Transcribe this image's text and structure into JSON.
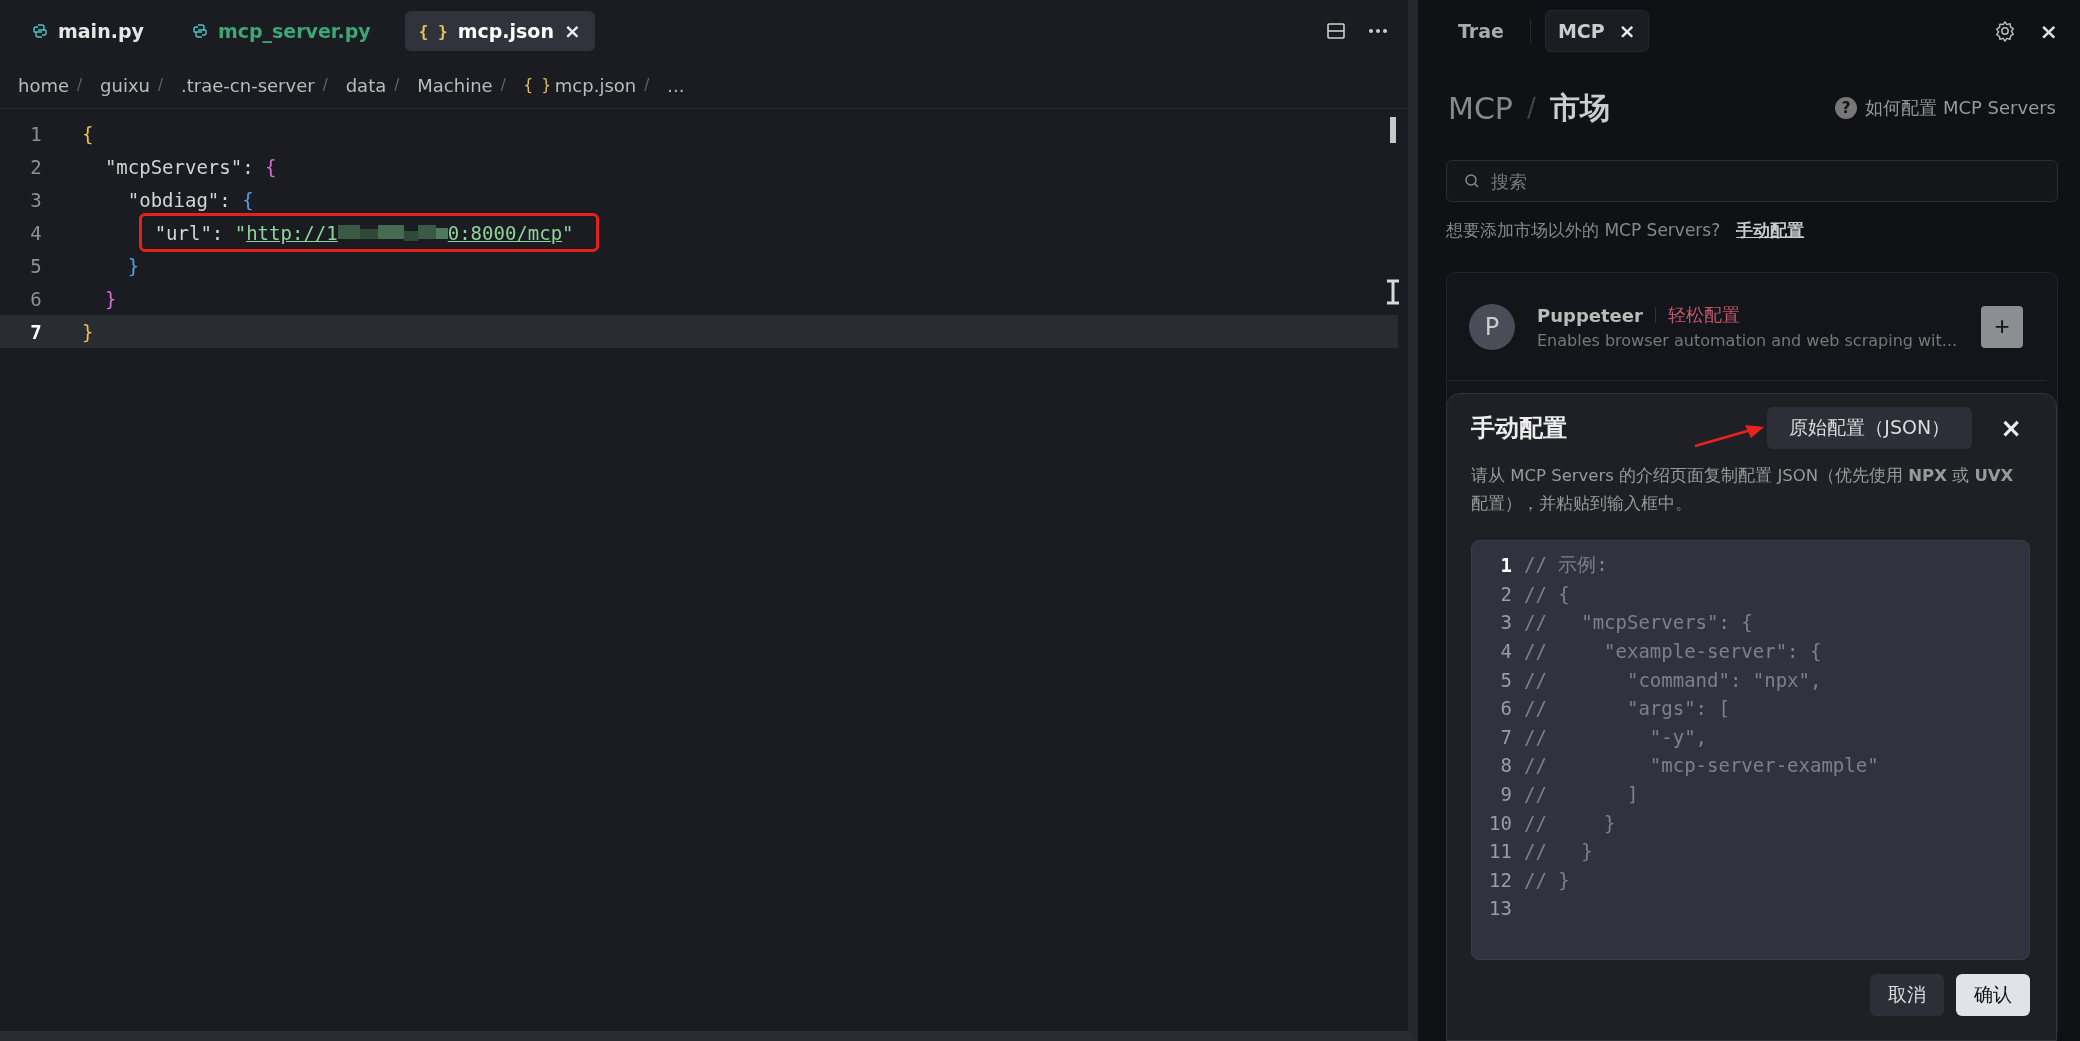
{
  "editor": {
    "tabs": [
      {
        "label": "main.py",
        "kind": "python",
        "selected": false,
        "color": "#e6e6e6"
      },
      {
        "label": "mcp_server.py",
        "kind": "python",
        "selected": false,
        "color": "#3ea675"
      },
      {
        "label": "mcp.json",
        "kind": "json",
        "icon_text": "{ }",
        "selected": true,
        "color": "#ffffff",
        "close": "×"
      }
    ],
    "breadcrumbs": [
      {
        "label": "home",
        "separator": "/"
      },
      {
        "label": "guixu",
        "separator": "/"
      },
      {
        "label": ".trae-cn-server",
        "separator": "/"
      },
      {
        "label": "data",
        "separator": "/"
      },
      {
        "label": "Machine",
        "separator": "/"
      },
      {
        "label": "mcp.json",
        "icon_text": "{ }",
        "separator": "/"
      },
      {
        "label": "..."
      }
    ],
    "lines": [
      {
        "number": "1",
        "current": false,
        "highlighted": false,
        "tokens": [
          {
            "kind": "brace",
            "text": "{",
            "color": "#e8c547"
          }
        ]
      },
      {
        "number": "2",
        "current": false,
        "highlighted": false,
        "tokens": [
          {
            "kind": "plain",
            "text": "  \"mcpServers\": "
          },
          {
            "kind": "brace",
            "text": "{",
            "color": "#d36fd0"
          }
        ]
      },
      {
        "number": "3",
        "current": false,
        "highlighted": false,
        "tokens": [
          {
            "kind": "plain",
            "text": "    \"obdiag\": "
          },
          {
            "kind": "brace",
            "text": "{",
            "color": "#4aa3f0"
          }
        ]
      },
      {
        "number": "4",
        "current": false,
        "highlighted": true,
        "tokens": [
          {
            "kind": "plain",
            "text": "      \"url\": "
          },
          {
            "kind": "string",
            "text": "\""
          },
          {
            "kind": "link",
            "text": "http://1"
          },
          {
            "kind": "redacted"
          },
          {
            "kind": "link",
            "text": "0:8000/mcp"
          },
          {
            "kind": "string",
            "text": "\""
          }
        ]
      },
      {
        "number": "5",
        "current": false,
        "highlighted": false,
        "tokens": [
          {
            "kind": "brace",
            "text": "    }",
            "color": "#4aa3f0"
          }
        ]
      },
      {
        "number": "6",
        "current": false,
        "highlighted": false,
        "tokens": [
          {
            "kind": "brace",
            "text": "  }",
            "color": "#d36fd0"
          }
        ]
      },
      {
        "number": "7",
        "current": true,
        "highlighted": false,
        "tokens": [
          {
            "kind": "brace",
            "text": "}",
            "color": "#e8c547"
          }
        ]
      }
    ]
  },
  "panel": {
    "tabs": [
      {
        "label": "Trae",
        "selected": false
      },
      {
        "label": "MCP",
        "selected": true,
        "close": "×"
      }
    ],
    "close": "×",
    "title": {
      "root": "MCP",
      "separator": "/",
      "current": "市场"
    },
    "help": {
      "icon_text": "?",
      "label": "如何配置 MCP Servers"
    },
    "search": {
      "placeholder": "搜索"
    },
    "hint": {
      "text": "想要添加市场以外的 MCP Servers?",
      "link": "手动配置"
    },
    "servers": [
      {
        "avatar": "P",
        "name": "Puppeteer",
        "tag": "轻松配置",
        "description": "Enables browser automation and web scraping wit...",
        "add": "+"
      }
    ]
  },
  "dialog": {
    "title": "手动配置",
    "raw_button": "原始配置（JSON）",
    "close": "×",
    "description": "请从 MCP Servers 的介绍页面复制配置 JSON（优先使用 **NPX** 或 **UVX** 配置），并粘贴到输入框中。",
    "code": [
      {
        "number": "1",
        "text": "// 示例:",
        "current": true
      },
      {
        "number": "2",
        "text": "// {",
        "current": false
      },
      {
        "number": "3",
        "text": "//   \"mcpServers\": {",
        "current": false
      },
      {
        "number": "4",
        "text": "//     \"example-server\": {",
        "current": false
      },
      {
        "number": "5",
        "text": "//       \"command\": \"npx\",",
        "current": false
      },
      {
        "number": "6",
        "text": "//       \"args\": [",
        "current": false
      },
      {
        "number": "7",
        "text": "//         \"-y\",",
        "current": false
      },
      {
        "number": "8",
        "text": "//         \"mcp-server-example\"",
        "current": false
      },
      {
        "number": "9",
        "text": "//       ]",
        "current": false
      },
      {
        "number": "10",
        "text": "//     }",
        "current": false
      },
      {
        "number": "11",
        "text": "//   }",
        "current": false
      },
      {
        "number": "12",
        "text": "// }",
        "current": false
      },
      {
        "number": "13",
        "current": false
      }
    ],
    "buttons": [
      {
        "label": "取消",
        "kind": "secondary"
      },
      {
        "label": "确认",
        "kind": "primary"
      }
    ],
    "annotation": {
      "kind": "arrow"
    }
  }
}
